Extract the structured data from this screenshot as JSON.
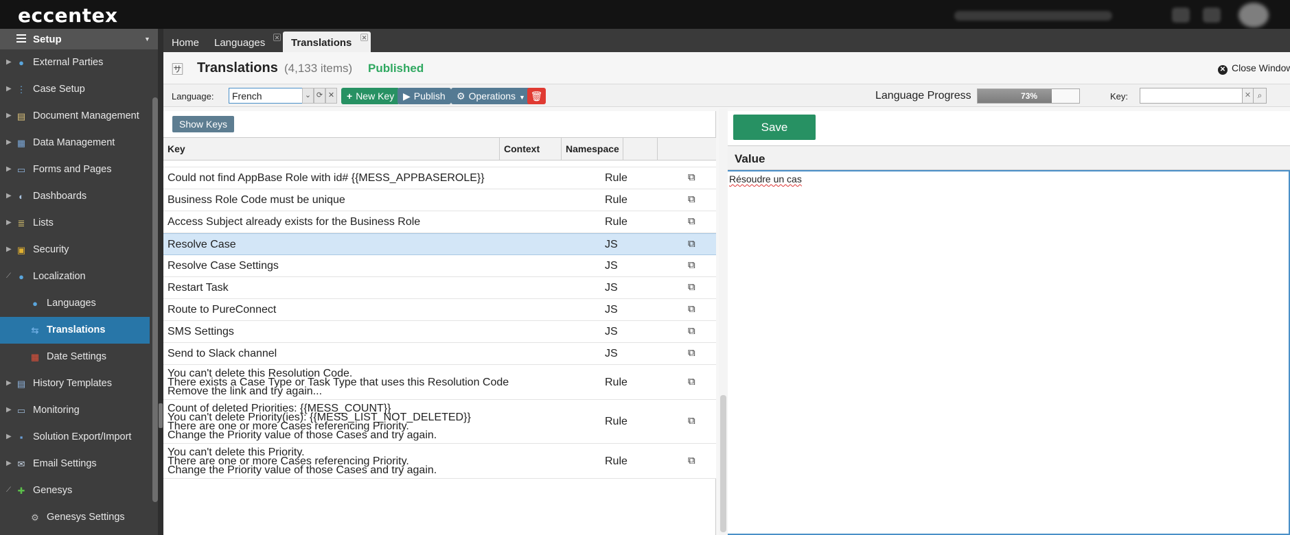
{
  "app": {
    "logo": "eccentex"
  },
  "sidebar": {
    "header": "Setup",
    "items": [
      {
        "label": "External Parties",
        "icon": "globe-icon",
        "level": "top",
        "expand": "collapsed"
      },
      {
        "label": "Case Setup",
        "icon": "case-setup-icon",
        "level": "top",
        "expand": "collapsed"
      },
      {
        "label": "Document Management",
        "icon": "document-icon",
        "level": "top",
        "expand": "collapsed"
      },
      {
        "label": "Data Management",
        "icon": "table-icon",
        "level": "top",
        "expand": "collapsed"
      },
      {
        "label": "Forms and Pages",
        "icon": "form-icon",
        "level": "top",
        "expand": "collapsed"
      },
      {
        "label": "Dashboards",
        "icon": "dashboard-icon",
        "level": "top",
        "expand": "collapsed"
      },
      {
        "label": "Lists",
        "icon": "list-icon",
        "level": "top",
        "expand": "collapsed"
      },
      {
        "label": "Security",
        "icon": "lock-icon",
        "level": "top",
        "expand": "collapsed"
      },
      {
        "label": "Localization",
        "icon": "globe-icon",
        "level": "top",
        "expand": "expanded"
      },
      {
        "label": "Languages",
        "icon": "globe-icon",
        "level": "sub",
        "expand": "none"
      },
      {
        "label": "Translations",
        "icon": "translate-icon",
        "level": "sub",
        "expand": "none",
        "active": true
      },
      {
        "label": "Date Settings",
        "icon": "calendar-icon",
        "level": "sub",
        "expand": "none"
      },
      {
        "label": "History Templates",
        "icon": "history-icon",
        "level": "top",
        "expand": "collapsed"
      },
      {
        "label": "Monitoring",
        "icon": "monitor-icon",
        "level": "top",
        "expand": "collapsed"
      },
      {
        "label": "Solution Export/Import",
        "icon": "save-icon",
        "level": "top",
        "expand": "collapsed"
      },
      {
        "label": "Email Settings",
        "icon": "email-icon",
        "level": "top",
        "expand": "collapsed"
      },
      {
        "label": "Genesys",
        "icon": "puzzle-icon",
        "level": "top",
        "expand": "expanded"
      },
      {
        "label": "Genesys Settings",
        "icon": "gear-icon",
        "level": "sub",
        "expand": "none"
      }
    ]
  },
  "tabs": [
    {
      "label": "Home",
      "closable": false,
      "active": false
    },
    {
      "label": "Languages",
      "closable": true,
      "active": false
    },
    {
      "label": "Translations",
      "closable": true,
      "active": true
    }
  ],
  "page": {
    "title": "Translations",
    "count": "(4,133 items)",
    "status": "Published",
    "close_label": "Close Window"
  },
  "toolbar": {
    "language_label": "Language:",
    "language_value": "French",
    "new_key": "New Key",
    "publish": "Publish",
    "operations": "Operations",
    "progress_label": "Language Progress",
    "progress_value": 0.73,
    "progress_text": "73%",
    "key_label": "Key:",
    "key_value": ""
  },
  "left": {
    "show_keys": "Show Keys",
    "columns": {
      "key": "Key",
      "context": "Context",
      "namespace": "Namespace"
    },
    "rows": [
      {
        "lines": [
          "Could not find AppBase Role with id# {{MESS_APPBASEROLE}}"
        ],
        "namespace": "Rule"
      },
      {
        "lines": [
          "Business Role Code must be unique"
        ],
        "namespace": "Rule"
      },
      {
        "lines": [
          "Access Subject already exists for the Business Role"
        ],
        "namespace": "Rule"
      },
      {
        "lines": [
          "Resolve Case"
        ],
        "namespace": "JS",
        "selected": true
      },
      {
        "lines": [
          "Resolve Case Settings"
        ],
        "namespace": "JS"
      },
      {
        "lines": [
          "Restart Task"
        ],
        "namespace": "JS"
      },
      {
        "lines": [
          "Route to PureConnect"
        ],
        "namespace": "JS"
      },
      {
        "lines": [
          "SMS Settings"
        ],
        "namespace": "JS"
      },
      {
        "lines": [
          "Send to Slack channel"
        ],
        "namespace": "JS"
      },
      {
        "lines": [
          "You can't delete this Resolution Code.",
          "There exists a Case Type or Task Type that uses this Resolution Code",
          "Remove the link and try again..."
        ],
        "namespace": "Rule"
      },
      {
        "lines": [
          "Count of deleted Priorities: {{MESS_COUNT}}",
          "You can't delete Priority(ies): {{MESS_LIST_NOT_DELETED}}",
          "There are one or more Cases referencing Priority.",
          "Change the Priority value of those Cases and try again."
        ],
        "namespace": "Rule"
      },
      {
        "lines": [
          "You can't delete this Priority.",
          "There are one or more Cases referencing Priority.",
          "Change the Priority value of those Cases and try again."
        ],
        "namespace": "Rule"
      }
    ]
  },
  "right": {
    "save": "Save",
    "value_header": "Value",
    "value_text": "Résoudre un cas"
  }
}
